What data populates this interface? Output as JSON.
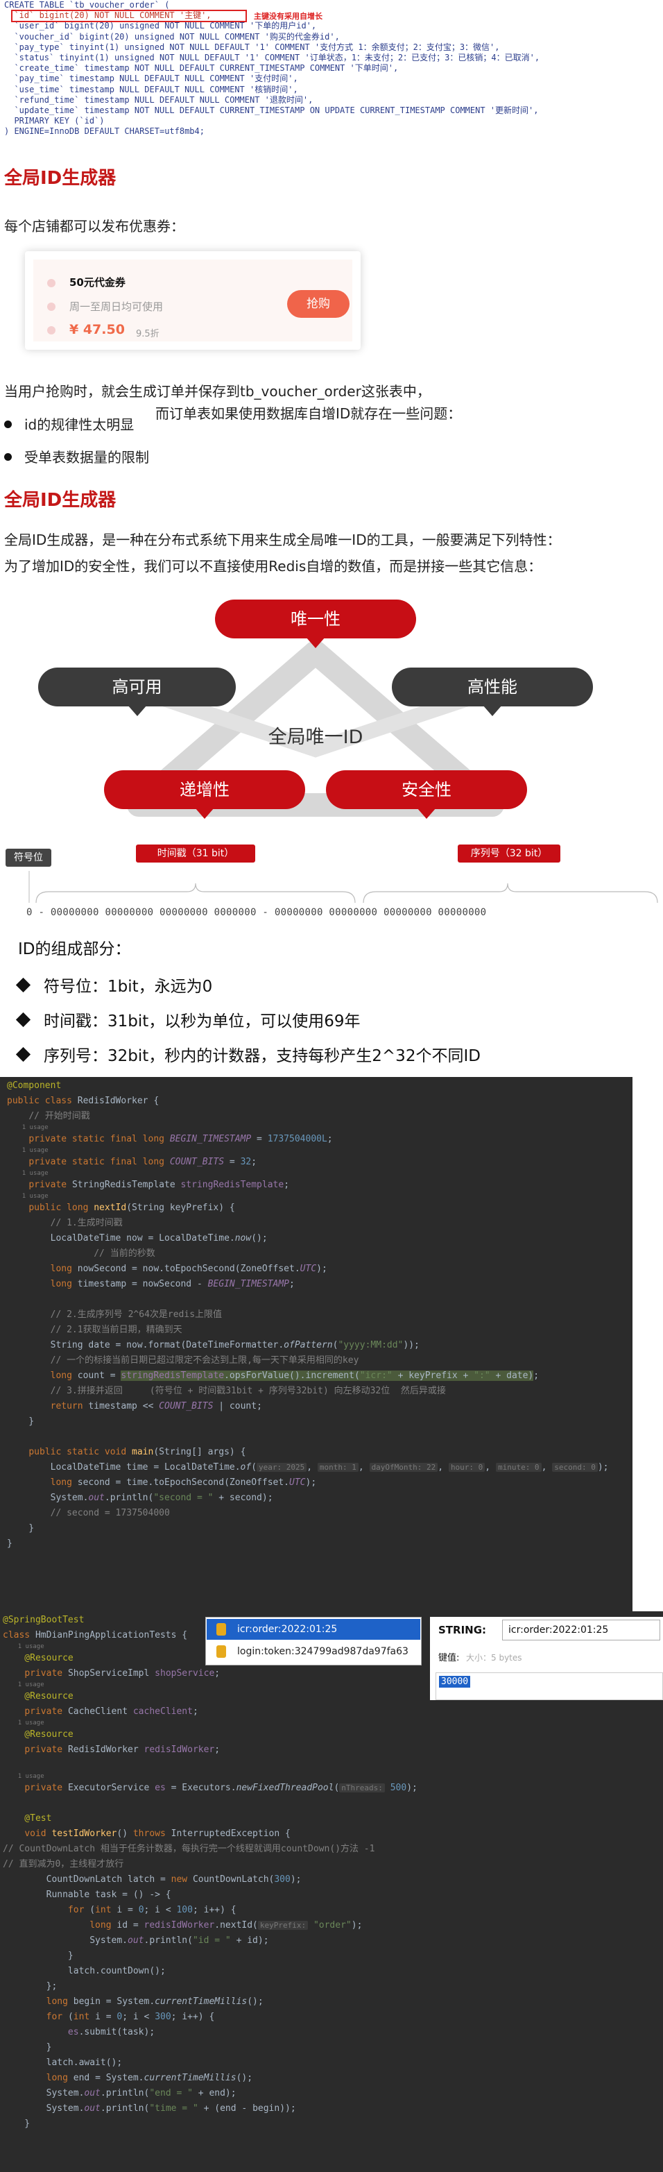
{
  "sql": {
    "lines": [
      "CREATE TABLE `tb_voucher_order` (",
      "  `id` bigint(20) NOT NULL COMMENT '主键',",
      "  `user_id` bigint(20) unsigned NOT NULL COMMENT '下单的用户id',",
      "  `voucher_id` bigint(20) unsigned NOT NULL COMMENT '购买的代金券id',",
      "  `pay_type` tinyint(1) unsigned NOT NULL DEFAULT '1' COMMENT '支付方式 1：余额支付；2：支付宝；3：微信',",
      "  `status` tinyint(1) unsigned NOT NULL DEFAULT '1' COMMENT '订单状态，1：未支付；2：已支付；3：已核销；4：已取消',",
      "  `create_time` timestamp NOT NULL DEFAULT CURRENT_TIMESTAMP COMMENT '下单时间',",
      "  `pay_time` timestamp NULL DEFAULT NULL COMMENT '支付时间',",
      "  `use_time` timestamp NULL DEFAULT NULL COMMENT '核销时间',",
      "  `refund_time` timestamp NULL DEFAULT NULL COMMENT '退款时间',",
      "  `update_time` timestamp NOT NULL DEFAULT CURRENT_TIMESTAMP ON UPDATE CURRENT_TIMESTAMP COMMENT '更新时间',",
      "  PRIMARY KEY (`id`)",
      ") ENGINE=InnoDB DEFAULT CHARSET=utf8mb4;"
    ],
    "annotation": "主键没有采用自增长"
  },
  "section1": {
    "heading": "全局ID生成器",
    "intro": "每个店铺都可以发布优惠券：",
    "coupon": {
      "title": "50元代金券",
      "subtitle": "周一至周日均可使用",
      "price": "¥ 47.50",
      "discount": "9.5折",
      "button": "抢购"
    },
    "para1": "当用户抢购时，就会生成订单并保存到tb_voucher_order这张表中，",
    "para2": "而订单表如果使用数据库自增ID就存在一些问题：",
    "bullets": [
      "id的规律性太明显",
      "受单表数据量的限制"
    ]
  },
  "section2": {
    "heading": "全局ID生成器",
    "para1": "全局ID生成器，是一种在分布式系统下用来生成全局唯一ID的工具，一般要满足下列特性：",
    "para2": "为了增加ID的安全性，我们可以不直接使用Redis自增的数值，而是拼接一些其它信息："
  },
  "diagram": {
    "center": "全局唯一ID",
    "top": "唯一性",
    "left": "高可用",
    "right": "高性能",
    "bottom_left": "递增性",
    "bottom_right": "安全性"
  },
  "bits": {
    "sign_label": "符号位",
    "time_label": "时间戳（31 bit）",
    "seq_label": "序列号（32 bit）",
    "bit_string": "0 - 00000000 00000000 00000000 0000000 - 00000000 00000000 00000000 00000000"
  },
  "id_composition": {
    "title": "ID的组成部分：",
    "items": [
      "符号位：1bit，永远为0",
      "时间戳：31bit，以秒为单位，可以使用69年",
      "序列号：32bit，秒内的计数器，支持每秒产生2^32个不同ID"
    ]
  },
  "code1": {
    "usage": "1 usage",
    "usages": "2 usages",
    "comment_begin": "// 开始时间戳",
    "comment_seq_bits": "// 序列号的位数",
    "comment_gen_ts": "// 1.生成时间戳",
    "comment_cur_sec": "// 当前的秒数",
    "comment_gen_seq": "// 2.生成序列号 2^64次是redis上限值",
    "comment_date": "// 2.1获取当前日期，精确到天",
    "comment_key": "// 一个的标接当前日期已超过限定不会达到上限,每一天下单采用相同的key",
    "comment_return": "// 3.拼接并返回     (符号位 + 时间戳31bit + 序列号32bit) 向左移动32位  然后异或接",
    "comment_second": "// second = 1737504000",
    "begin_value": "1737504000L",
    "count_bits_value": "32",
    "date_pattern": "\"yyyy:MM:dd\"",
    "icr_prefix": "\"icr:\"",
    "colon": "\":\"",
    "second_label": "\"second = \"",
    "hint_year": "year: 2025",
    "hint_month": "month: 1",
    "hint_day": "dayOfMonth: 22",
    "hint_hour": "hour: 0",
    "hint_minute": "minute: 0",
    "hint_second": "second: 0",
    "hint_delta": "1: "
  },
  "code2": {
    "usage": "1 usage",
    "comment1": "// CountDownLatch 相当于任务计数器，每执行完一个线程就调用countDown()方法 -1",
    "comment2": "// 直到减为0，主线程才放行",
    "order_str": "\"order\"",
    "id_str": "\"id = \"",
    "end_str": "\"end = \"",
    "time_str": "\"time = \"",
    "latch_count": "300",
    "loop_count": "100",
    "loop_count2": "300",
    "pool_size": "500",
    "hint_key": "keyPrefix:",
    "hint_threads": "nThreads:"
  },
  "redis": {
    "keys": [
      "icr:order:2022:01:25",
      "login:token:324799ad987da97fa63"
    ],
    "string_label": "STRING:",
    "key_value": "icr:order:2022:01:25",
    "value_label": "键值:",
    "size_hint": "大小：5 bytes",
    "value": "30000"
  },
  "colors": {
    "accent_red": "#c41818",
    "pill_red": "#c70e15",
    "pill_dark": "#3b3b3b",
    "coupon_button": "#f0644a",
    "code_bg": "#2b2b2b"
  }
}
